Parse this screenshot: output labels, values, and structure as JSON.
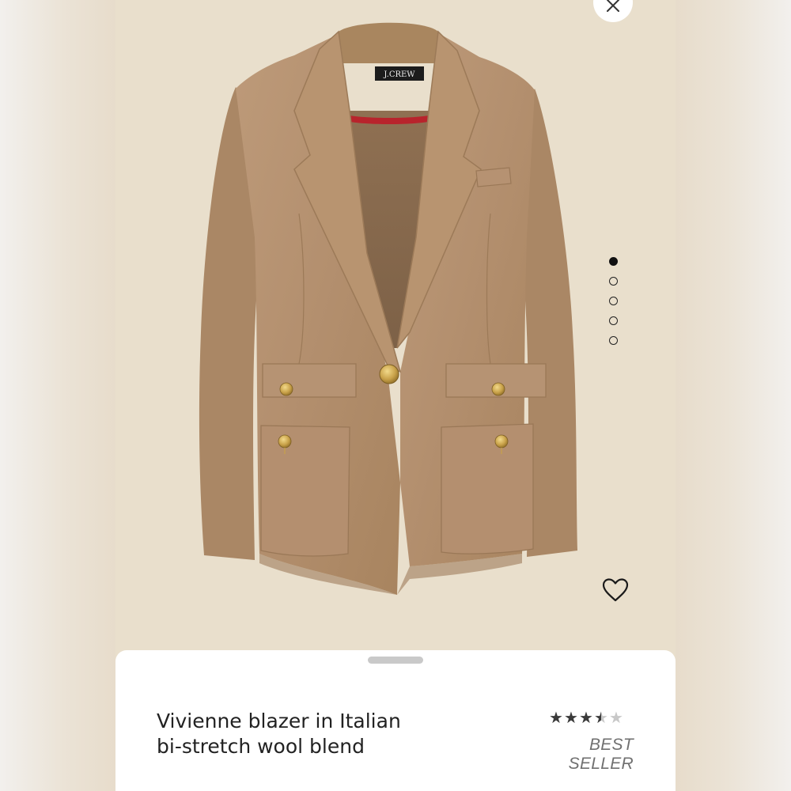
{
  "product": {
    "title": "Vivienne blazer in Italian bi-stretch wool blend",
    "badge": "BEST SELLER",
    "rating_stars": 3.5,
    "rating_max": 5,
    "brand_label": "J.CREW"
  },
  "carousel": {
    "dot_count": 5,
    "active_index": 0
  },
  "icons": {
    "close": "close-icon",
    "favorite": "heart-outline-icon",
    "star": "star-icon"
  },
  "colors": {
    "backdrop": "#e9dfcc",
    "blazer": "#b38f6e",
    "lining_accent": "#b8242c",
    "button_gold": "#c9a24a"
  }
}
